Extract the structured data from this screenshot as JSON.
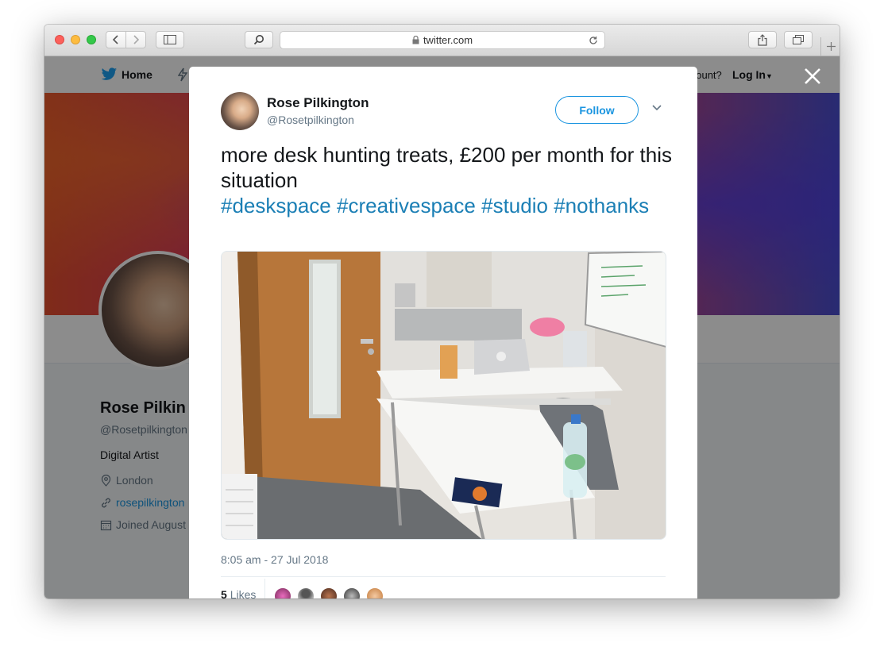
{
  "browser": {
    "url": "twitter.com"
  },
  "background_page": {
    "nav": {
      "home_label": "Home",
      "account_prompt": "account?",
      "login_label": "Log In"
    },
    "profile": {
      "name": "Rose Pilkin",
      "handle": "@Rosetpilkington",
      "bio": "Digital Artist",
      "location": "London",
      "website": "rosepilkington",
      "joined": "Joined August"
    }
  },
  "modal": {
    "author_name": "Rose Pilkington",
    "author_handle": "@Rosetpilkington",
    "follow_label": "Follow",
    "tweet_text_line1": "more desk hunting treats, £200 per month for this situation",
    "hashtags": [
      "#deskspace",
      "#creativespace",
      "#studio",
      "#nothanks"
    ],
    "timestamp": "8:05 am - 27 Jul 2018",
    "likes_count": "5",
    "likes_label": "Likes"
  },
  "colors": {
    "twitter_blue": "#1b95e0",
    "hashtag_blue": "#1b7fb5",
    "text_dark": "#14171a",
    "text_muted": "#657786"
  }
}
